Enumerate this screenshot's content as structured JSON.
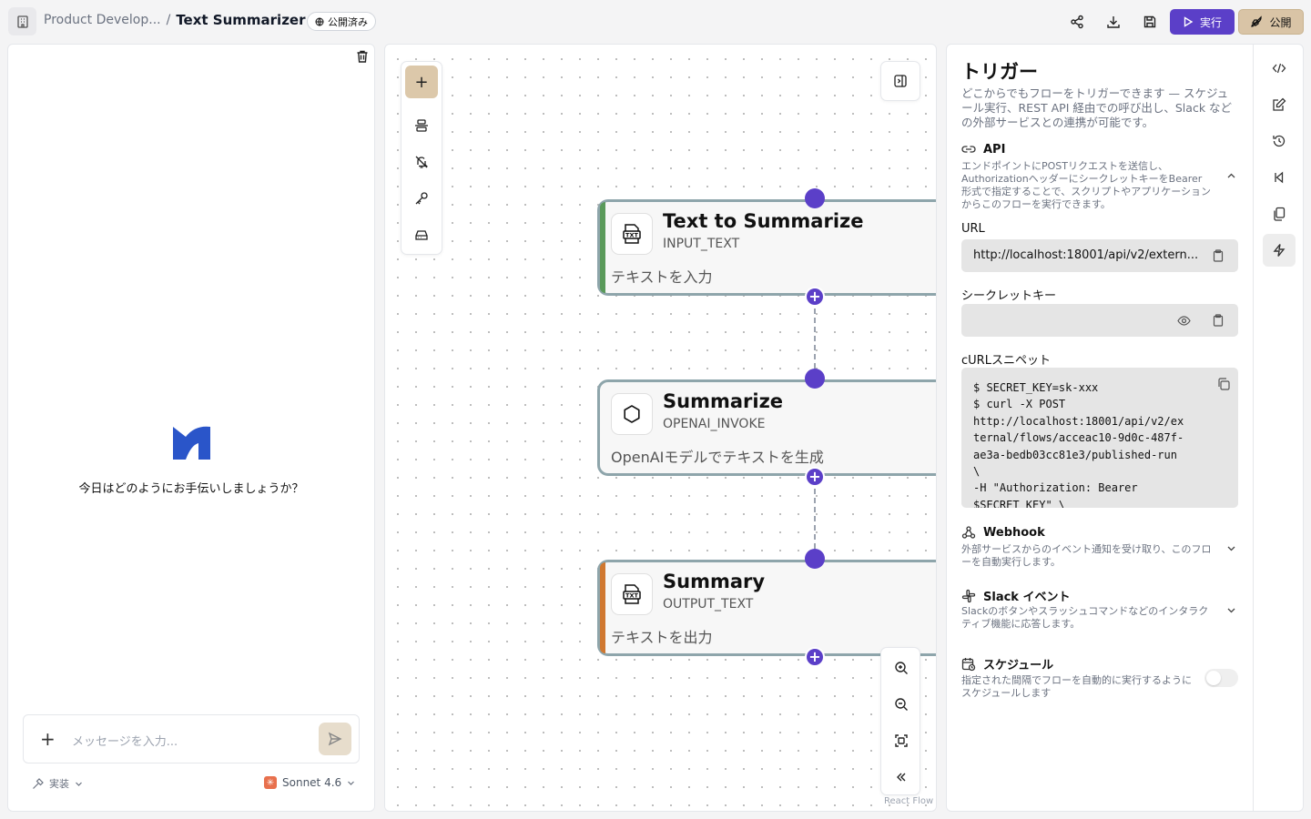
{
  "header": {
    "project": "Product Develop...",
    "separator": "/",
    "flow_name": "Text Summarizer",
    "status_badge": "公開済み",
    "run_label": "実行",
    "publish_label": "公開"
  },
  "chat": {
    "greeting": "今日はどのようにお手伝いしましょうか？",
    "input_placeholder": "メッセージを入力...",
    "mode_label": "実装",
    "model_label": "Sonnet 4.6"
  },
  "canvas": {
    "nodes": [
      {
        "title": "Text to Summarize",
        "type": "INPUT_TEXT",
        "description": "テキストを入力",
        "stripe_color": "#5a9a5a"
      },
      {
        "title": "Summarize",
        "type": "OPENAI_INVOKE",
        "description": "OpenAIモデルでテキストを生成",
        "stripe_color": "none"
      },
      {
        "title": "Summary",
        "type": "OUTPUT_TEXT",
        "description": "テキストを出力",
        "stripe_color": "#d07830"
      }
    ],
    "attribution": "React Flow"
  },
  "trigger_panel": {
    "title": "トリガー",
    "description": "どこからでもフローをトリガーできます — スケジュール実行、REST API 経由での呼び出し、Slack などの外部サービスとの連携が可能です。",
    "api": {
      "label": "API",
      "description": "エンドポイントにPOSTリクエストを送信し、AuthorizationヘッダーにシークレットキーをBearer形式で指定することで、スクリプトやアプリケーションからこのフローを実行できます。",
      "url_label": "URL",
      "url_value": "http://localhost:18001/api/v2/extern...",
      "secret_label": "シークレットキー",
      "secret_value": "",
      "curl_label": "cURLスニペット",
      "curl_snippet": "$ SECRET_KEY=sk-xxx\n$ curl -X POST\nhttp://localhost:18001/api/v2/ex\nternal/flows/acceac10-9d0c-487f-\nae3a-bedb03cc81e3/published-run\n\\\n-H \"Authorization: Bearer\n$SECRET_KEY\" \\"
    },
    "webhook": {
      "label": "Webhook",
      "description": "外部サービスからのイベント通知を受け取り、このフローを自動実行します。"
    },
    "slack": {
      "label": "Slack イベント",
      "description": "Slackのボタンやスラッシュコマンドなどのインタラクティブ機能に応答します。"
    },
    "schedule": {
      "label": "スケジュール",
      "description": "指定された間隔でフローを自動的に実行するようにスケジュールします",
      "enabled": false
    }
  },
  "colors": {
    "accent": "#5b3fc8",
    "publish": "#d9c4a6",
    "node_border": "#8ea5ab"
  }
}
